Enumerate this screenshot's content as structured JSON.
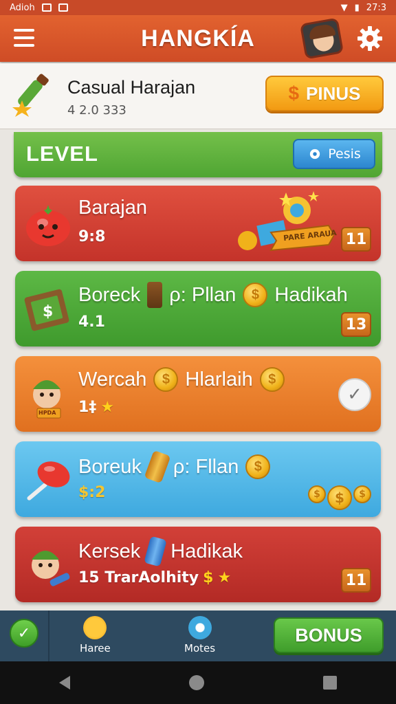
{
  "status_bar": {
    "left_text": "Adioh",
    "right_text": "27:3"
  },
  "app": {
    "title": "HANGKÍA"
  },
  "profile": {
    "name": "Casual Harajan",
    "score": "4 2.0 333",
    "pinus_label": "PINUS",
    "pinus_symbol": "$"
  },
  "level_bar": {
    "label": "LEVEL",
    "button_label": "Pesis"
  },
  "cards": [
    {
      "title": "Barajan",
      "subtitle": "9:8",
      "badge": "11",
      "banner": "PARE ARAUA",
      "color": "red"
    },
    {
      "title_a": "Boreck",
      "title_b": "ρ: Pllan",
      "title_c": "Hadikah",
      "subtitle": "4.1",
      "badge": "13",
      "color": "green"
    },
    {
      "title_a": "Wercah",
      "title_b": "Hlarlaih",
      "subtitle": "1‡",
      "mascot_sign": "HPDA",
      "color": "orange"
    },
    {
      "title_a": "Boreuk",
      "title_b": "ρ: Fllan",
      "subtitle": "$:2",
      "color": "blue"
    },
    {
      "title_a": "Kersek",
      "title_b": "Hadikak",
      "subtitle": "15 TrarAolhity",
      "subtitle_symbol": "$",
      "badge": "11",
      "color": "crimson"
    }
  ],
  "bottom_nav": {
    "item1": "Haree",
    "item2": "Motes",
    "bonus_label": "BONUS"
  },
  "icons": {
    "menu": "hamburger-icon",
    "settings": "gear-icon",
    "coin": "dollar-coin-icon",
    "star": "star-icon",
    "check": "checkmark-icon"
  },
  "colors": {
    "appbar": "#d8552a",
    "level": "#5fb03d",
    "nav": "#2e4a60",
    "pinus": "#f5a623"
  }
}
